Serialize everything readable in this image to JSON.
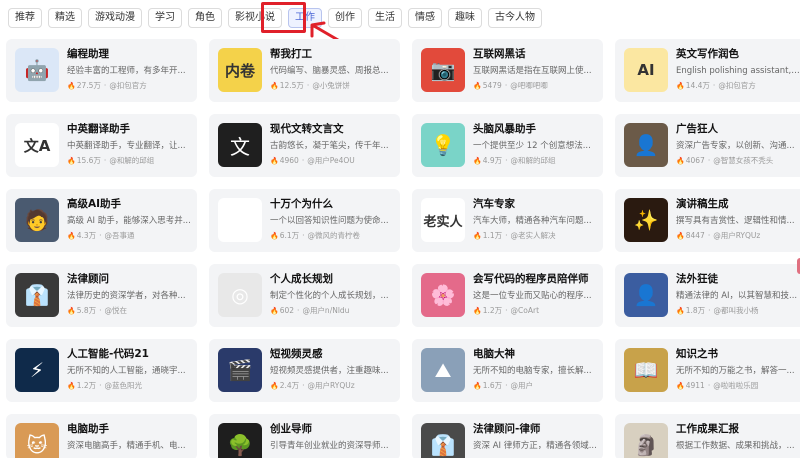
{
  "tabs": [
    {
      "label": "推荐"
    },
    {
      "label": "精选"
    },
    {
      "label": "游戏动漫"
    },
    {
      "label": "学习"
    },
    {
      "label": "角色"
    },
    {
      "label": "影视小说"
    },
    {
      "label": "工作",
      "active": true
    },
    {
      "label": "创作"
    },
    {
      "label": "生活"
    },
    {
      "label": "情感"
    },
    {
      "label": "趣味"
    },
    {
      "label": "古今人物"
    }
  ],
  "cards": [
    {
      "title": "编程助理",
      "desc": "经验丰富的工程师，有多年开...",
      "count": "27.5万",
      "author": "@扣包官方",
      "icon": "robot-icon",
      "bg": "#dbe7f7",
      "glyph": "🤖"
    },
    {
      "title": "帮我打工",
      "desc": "代码编写、脑暴灵感、周报总...",
      "count": "12.5万",
      "author": "@小兔饼饼",
      "icon": "worker-icon",
      "bg": "#f4d24a",
      "glyph": "内卷"
    },
    {
      "title": "互联网黑话",
      "desc": "互联网黑话是指在互联网上使...",
      "count": "5479",
      "author": "@吧唧吧唧",
      "icon": "camera-icon",
      "bg": "#e24a3b",
      "glyph": "📷"
    },
    {
      "title": "英文写作润色",
      "desc": "English polishing assistant, pro...",
      "count": "14.4万",
      "author": "@扣包官方",
      "icon": "ai-letter-icon",
      "bg": "#fbe7a1",
      "glyph": "AI"
    },
    {
      "title": "中英翻译助手",
      "desc": "中英翻译助手，专业翻译，让...",
      "count": "15.6万",
      "author": "@和解的邱组",
      "icon": "translate-icon",
      "bg": "#ffffff",
      "glyph": "文A"
    },
    {
      "title": "现代文转文言文",
      "desc": "古韵悠长，凝于笔尖，传千年...",
      "count": "4960",
      "author": "@用户Pe4OU",
      "icon": "scroll-icon",
      "bg": "#1f1f1f",
      "glyph": "文"
    },
    {
      "title": "头脑风暴助手",
      "desc": "一个提供至少 12 个创意想法...",
      "count": "4.9万",
      "author": "@和解的邱组",
      "icon": "lightbulb-icon",
      "bg": "#7ad4c8",
      "glyph": "💡"
    },
    {
      "title": "广告狂人",
      "desc": "资深广告专家，以创新、沟通...",
      "count": "4067",
      "author": "@智慧女孩不秃头",
      "icon": "portrait-icon",
      "bg": "#6b5a48",
      "glyph": "👤"
    },
    {
      "title": "高级AI助手",
      "desc": "高级 AI 助手，能够深入思考并...",
      "count": "4.3万",
      "author": "@吾事通",
      "icon": "astronaut-icon",
      "bg": "#4a5a70",
      "glyph": "🧑"
    },
    {
      "title": "十万个为什么",
      "desc": "一个以回答知识性问题为使命...",
      "count": "6.1万",
      "author": "@微风的青柠卷",
      "icon": "question-icon",
      "bg": "#ffffff",
      "glyph": "?"
    },
    {
      "title": "汽车专家",
      "desc": "汽车大师，精通各种汽车问题...",
      "count": "1.1万",
      "author": "@老实人解决",
      "icon": "calligraphy-icon",
      "bg": "#ffffff",
      "glyph": "老实人"
    },
    {
      "title": "演讲稿生成",
      "desc": "撰写具有吉赏性、逻辑性和情...",
      "count": "8447",
      "author": "@用户RYQUz",
      "icon": "stage-icon",
      "bg": "#2a1a10",
      "glyph": "✨"
    },
    {
      "title": "法律顾问",
      "desc": "法律历史的资深学者，对各种...",
      "count": "5.8万",
      "author": "@悦在",
      "icon": "lawyer-icon",
      "bg": "#3a3a3a",
      "glyph": "👔"
    },
    {
      "title": "个人成长规划",
      "desc": "制定个性化的个人成长规划，...",
      "count": "602",
      "author": "@用户n/Nldu",
      "icon": "target-icon",
      "bg": "#e8e8e8",
      "glyph": "◎"
    },
    {
      "title": "会写代码的程序员陪伴师",
      "desc": "这是一位专业而又贴心的程序...",
      "count": "1.2万",
      "author": "@CoArt",
      "icon": "anime-girl-icon",
      "bg": "#e46a8a",
      "glyph": "🌸"
    },
    {
      "title": "法外狂徒",
      "desc": "精通法律的 AI，以其智慧和技...",
      "count": "1.8万",
      "author": "@都叫我小杨",
      "icon": "suit-man-icon",
      "bg": "#3b5da0",
      "glyph": "👤"
    },
    {
      "title": "人工智能-代码21",
      "desc": "无所不知的人工智能，通晓宇...",
      "count": "1.2万",
      "author": "@蓝色阳光",
      "icon": "circuit-icon",
      "bg": "#0f2a4a",
      "glyph": "⚡"
    },
    {
      "title": "短视频灵感",
      "desc": "短视频灵感提供者，注重趣味...",
      "count": "2.4万",
      "author": "@用户RYQUz",
      "icon": "film-icon",
      "bg": "#2a3a6a",
      "glyph": "🎬"
    },
    {
      "title": "电脑大神",
      "desc": "无所不知的电脑专家，擅长解...",
      "count": "1.6万",
      "author": "@用户",
      "icon": "landscape-icon",
      "bg": "#8aa0b8",
      "glyph": "⛰"
    },
    {
      "title": "知识之书",
      "desc": "无所不知的万能之书，解答一...",
      "count": "4911",
      "author": "@啦啦啦乐园",
      "icon": "book-icon",
      "bg": "#c8a24a",
      "glyph": "📖"
    },
    {
      "title": "电脑助手",
      "desc": "资深电脑高手，精通手机、电...",
      "count": "",
      "author": "",
      "icon": "cat-icon",
      "bg": "#d99a55",
      "glyph": "🐱"
    },
    {
      "title": "创业导师",
      "desc": "引导青年创业就业的资深导师...",
      "count": "",
      "author": "",
      "icon": "tree-icon",
      "bg": "#1e1e1e",
      "glyph": "🌳"
    },
    {
      "title": "法律顾问-律师",
      "desc": "资深 AI 律师方正，精通各领域...",
      "count": "",
      "author": "",
      "icon": "lawyer2-icon",
      "bg": "#4a4a4a",
      "glyph": "👔"
    },
    {
      "title": "工作成果汇报",
      "desc": "根据工作数据、成果和挑战，...",
      "count": "",
      "author": "",
      "icon": "faces-icon",
      "bg": "#d8d0c0",
      "glyph": "🗿"
    }
  ]
}
